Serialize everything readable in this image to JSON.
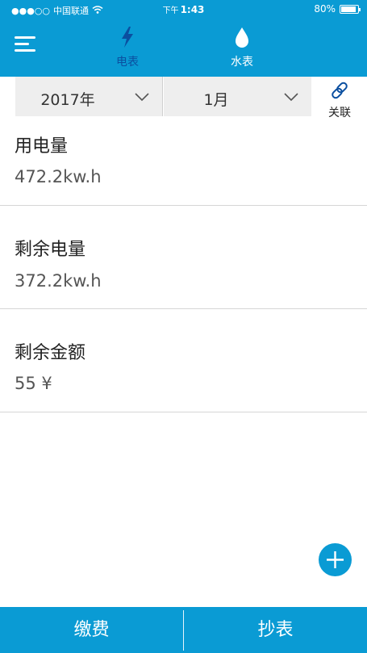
{
  "status_bar": {
    "signal": "●●●○○",
    "carrier": "中国联通",
    "ampm": "下午",
    "time": "1:43",
    "battery": "80%"
  },
  "header": {
    "tabs": [
      {
        "label": "电表",
        "icon": "lightning-icon",
        "active": true
      },
      {
        "label": "水表",
        "icon": "water-drop-icon",
        "active": false
      }
    ]
  },
  "filters": {
    "year": "2017年",
    "month": "1月",
    "link_label": "关联"
  },
  "info": [
    {
      "label": "用电量",
      "value": "472.2kw.h"
    },
    {
      "label": "剩余电量",
      "value": "372.2kw.h"
    },
    {
      "label": "剩余金额",
      "value": "55 ¥"
    }
  ],
  "bottom_bar": {
    "pay_label": "缴费",
    "read_label": "抄表"
  },
  "colors": {
    "primary": "#0a9bd4",
    "active_tab": "#0b4fa0",
    "filter_bg": "#eeeeee"
  }
}
